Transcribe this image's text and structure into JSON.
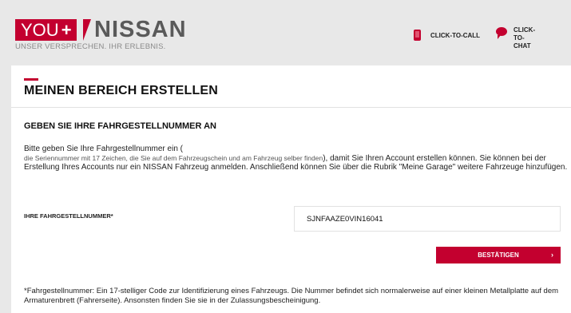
{
  "header": {
    "logo_you": "YOU",
    "logo_plus": "+",
    "logo_nissan": "NISSAN",
    "tagline": "UNSER VERSPRECHEN. IHR ERLEBNIS.",
    "click_to_call": "CLICK-TO-CALL",
    "click_to_chat_line1": "CLICK-TO-",
    "click_to_chat_line2": "CHAT"
  },
  "page": {
    "title": "MEINEN BEREICH ERSTELLEN",
    "section_title": "GEBEN SIE IHRE FAHRGESTELLNUMMER AN",
    "desc_part1": "Bitte geben Sie Ihre Fahrgestellnummer ein (",
    "desc_sub": "die Seriennummer mit 17 Zeichen, die Sie auf dem Fahrzeugschein und am Fahrzeug selber finden",
    "desc_part2": "), damit Sie Ihren Account erstellen können. Sie können bei der Erstellung Ihres Accounts nur ein NISSAN Fahrzeug anmelden. Anschließend können Sie über die Rubrik \"Meine Garage\" weitere Fahrzeuge hinzufügen.",
    "field_label": "IHRE FAHRGESTELLNUMMER*",
    "vin_value": "SJNFAAZE0VIN16041",
    "confirm_label": "BESTÄTIGEN",
    "confirm_chevron": "›",
    "footnote": "*Fahrgestellnummer: Ein 17-stelliger Code zur Identifizierung eines Fahrzeugs. Die Nummer befindet sich normalerweise auf einer kleinen Metallplatte auf dem Armaturenbrett (Fahrerseite). Ansonsten finden Sie sie in der Zulassungsbescheinigung."
  },
  "colors": {
    "brand_red": "#c3002f",
    "background": "#e8e8e8"
  },
  "icons": {
    "call": "phone-icon",
    "chat": "chat-bubble-icon"
  }
}
